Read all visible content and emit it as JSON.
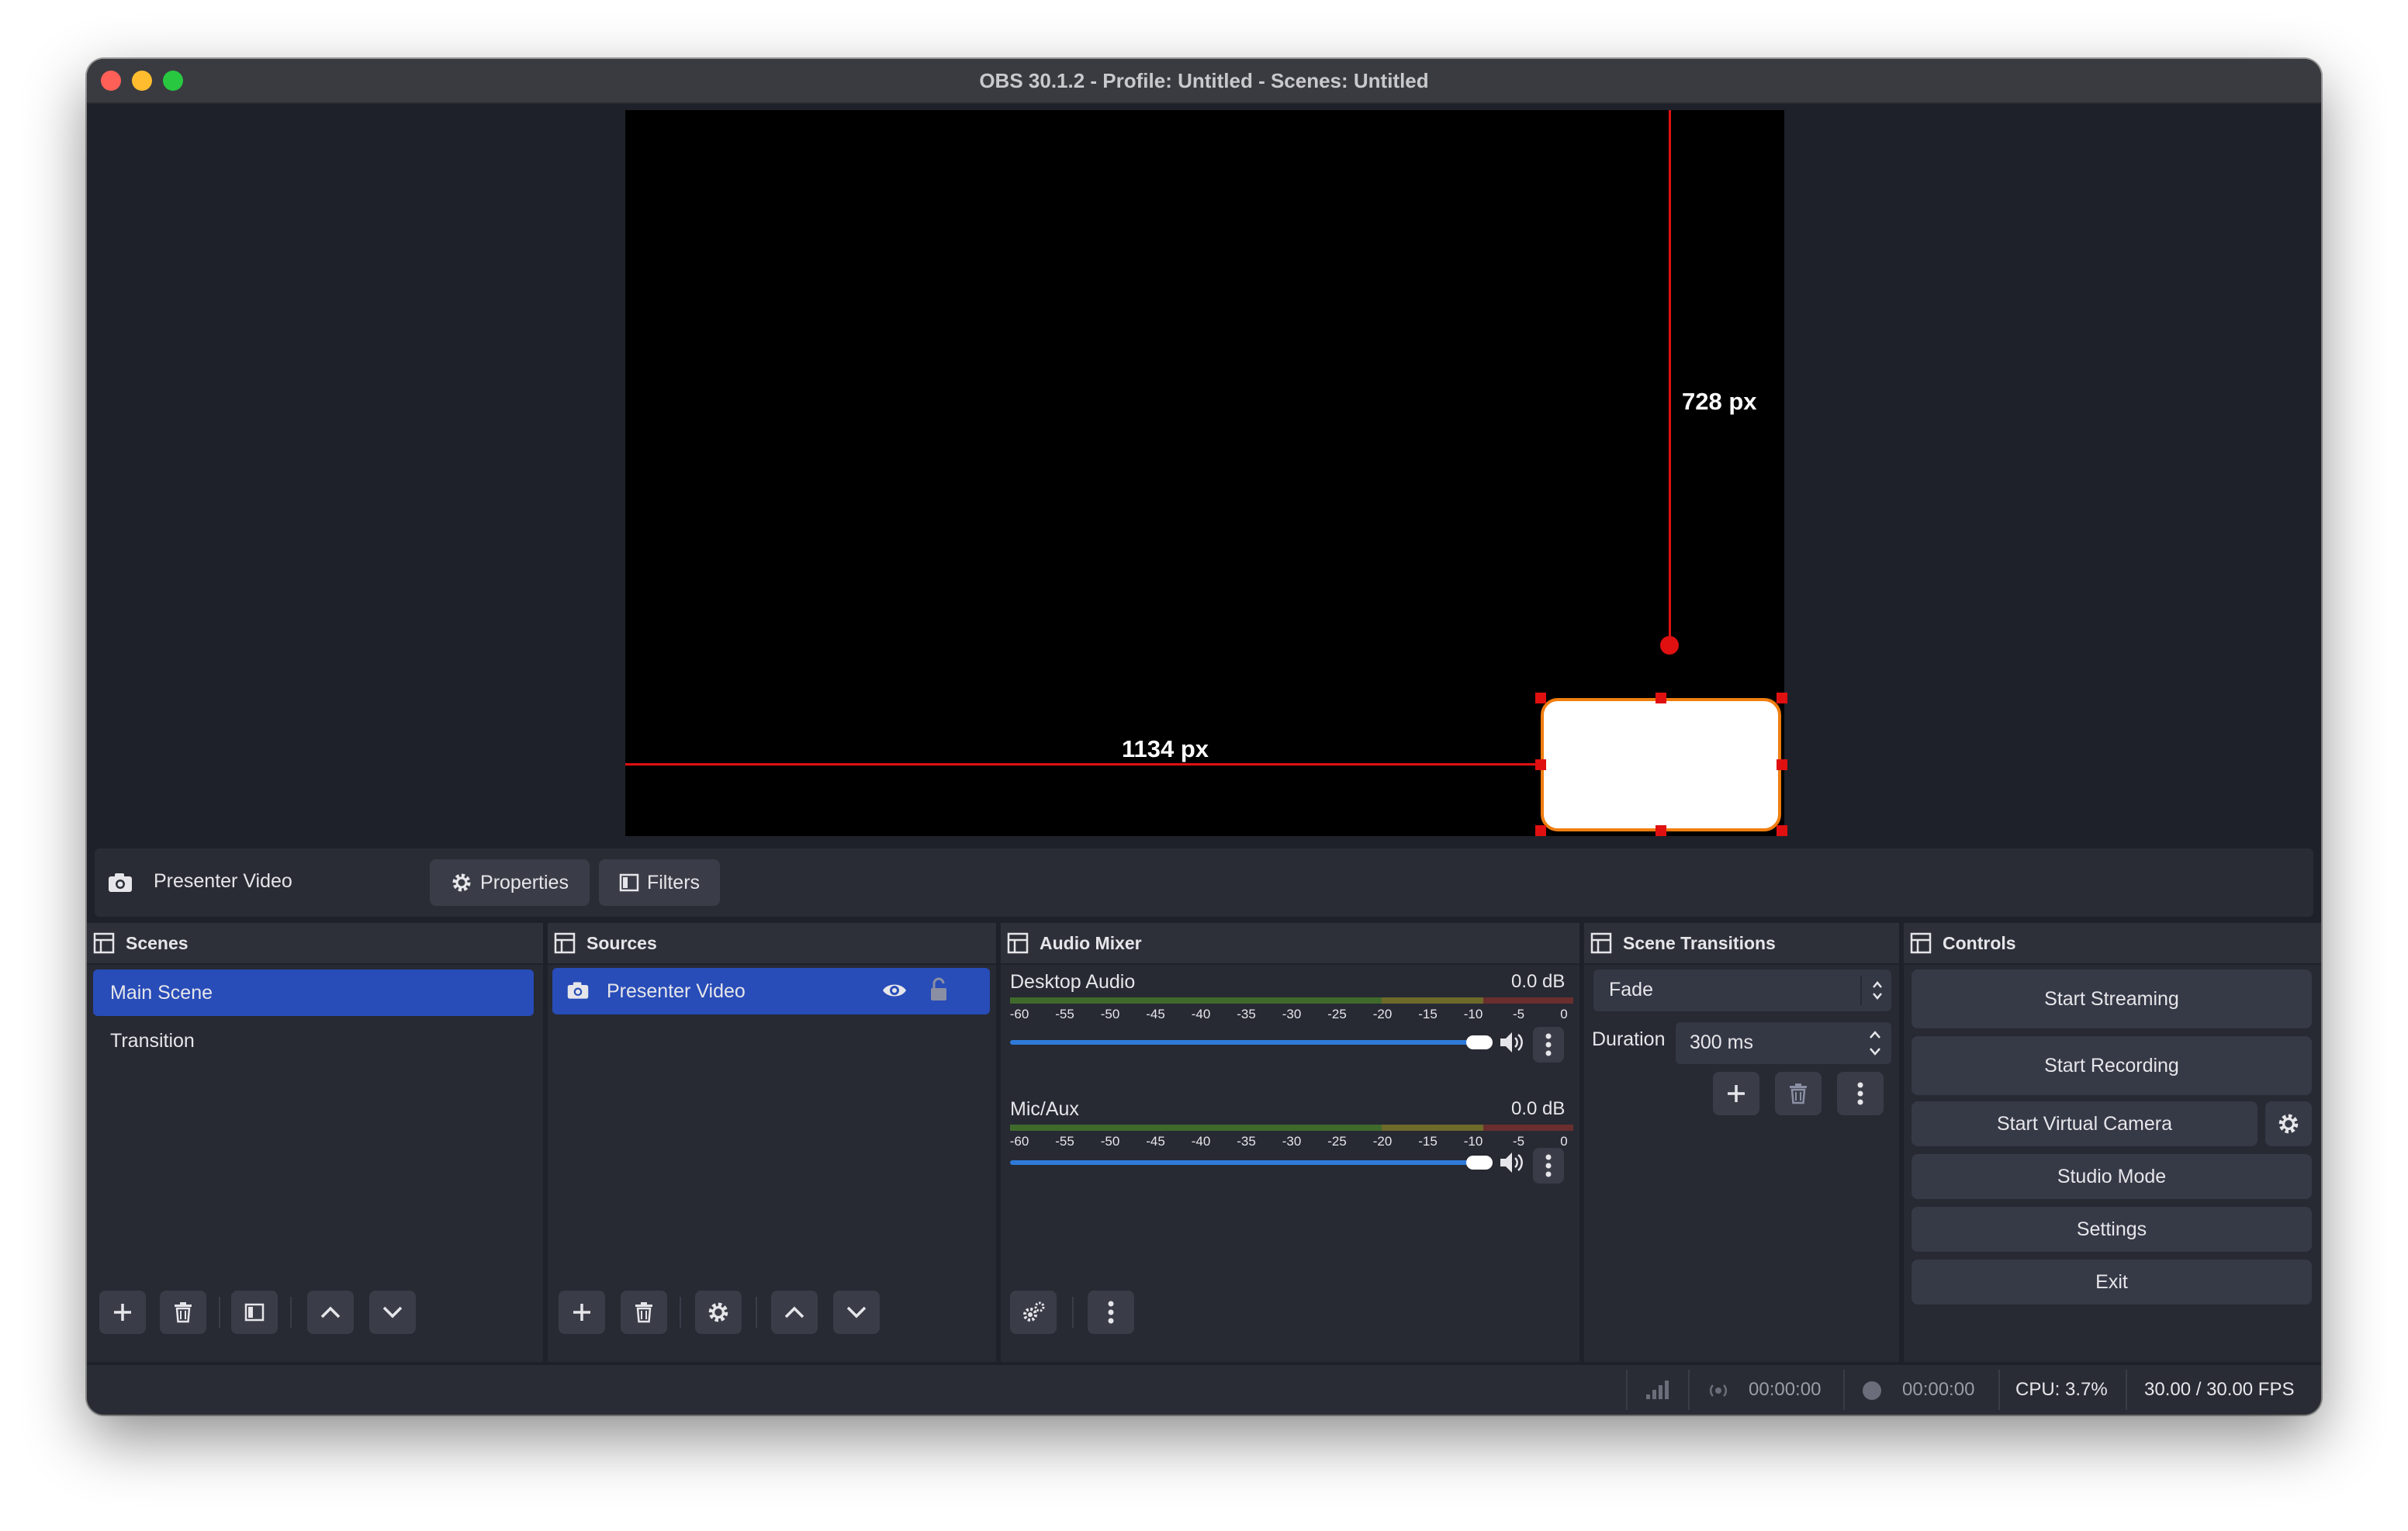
{
  "window": {
    "title": "OBS 30.1.2 - Profile: Untitled - Scenes: Untitled"
  },
  "preview": {
    "horizontal_distance_label": "1134 px",
    "vertical_distance_label": "728 px"
  },
  "context_bar": {
    "source_name": "Presenter Video",
    "properties_label": "Properties",
    "filters_label": "Filters"
  },
  "scenes": {
    "header": "Scenes",
    "items": [
      {
        "label": "Main Scene",
        "selected": true
      },
      {
        "label": "Transition",
        "selected": false
      }
    ]
  },
  "sources": {
    "header": "Sources",
    "items": [
      {
        "label": "Presenter Video",
        "selected": true,
        "visible": true,
        "locked": false
      }
    ]
  },
  "audio_mixer": {
    "header": "Audio Mixer",
    "channels": [
      {
        "name": "Desktop Audio",
        "db": "0.0 dB",
        "volume": 1.0
      },
      {
        "name": "Mic/Aux",
        "db": "0.0 dB",
        "volume": 1.0
      }
    ],
    "scale_labels": [
      "-60",
      "-55",
      "-50",
      "-45",
      "-40",
      "-35",
      "-30",
      "-25",
      "-20",
      "-15",
      "-10",
      "-5",
      "0"
    ]
  },
  "scene_transitions": {
    "header": "Scene Transitions",
    "transition": "Fade",
    "duration_label": "Duration",
    "duration_value": "300 ms"
  },
  "controls": {
    "header": "Controls",
    "start_streaming": "Start Streaming",
    "start_recording": "Start Recording",
    "start_virtual_camera": "Start Virtual Camera",
    "studio_mode": "Studio Mode",
    "settings": "Settings",
    "exit": "Exit"
  },
  "status_bar": {
    "stream_time": "00:00:00",
    "record_time": "00:00:00",
    "cpu": "CPU: 3.7%",
    "fps": "30.00 / 30.00 FPS"
  },
  "colors": {
    "selection": "#284cb8",
    "guide": "#e01010",
    "source_border": "#f07e10",
    "slider": "#2f7ad8"
  }
}
